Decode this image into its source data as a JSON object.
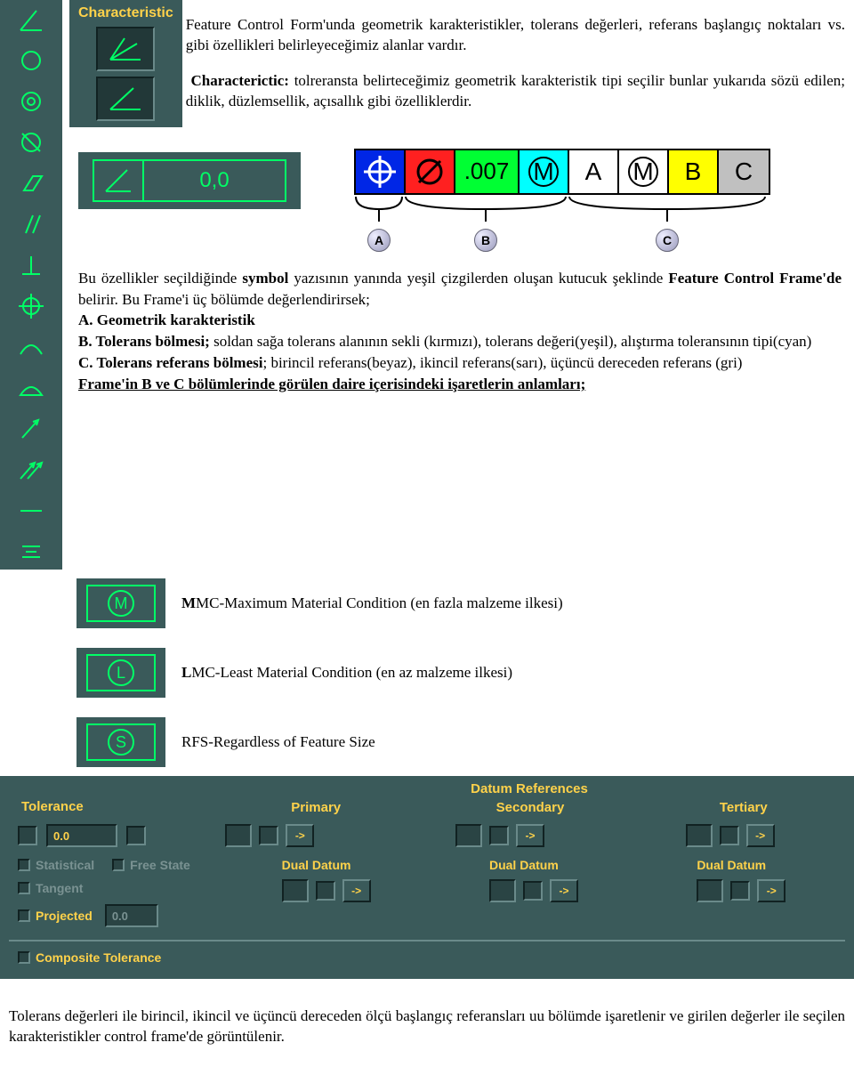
{
  "char_panel": {
    "title": "Characteristic",
    "angle_value": "0,0"
  },
  "intro_para": "Feature Control Form'unda geometrik karakteristikler, tolerans değerleri, referans başlangıç noktaları vs. gibi özellikleri belirleyeceğimiz alanlar vardır.",
  "intro_para2_lead": "Characterictic:",
  "intro_para2_rest": " tolreransta belirteceğimiz geometrik karakteristik tipi seçilir bunlar yukarıda sözü edilen; diklik, düzlemsellik, açısallık gibi özelliklerdir.",
  "fcf": {
    "tol_value": ".007",
    "cyan_letter": "M",
    "datum_primary": "A",
    "datum_primary_mod": "M",
    "datum_secondary": "B",
    "datum_tertiary": "C",
    "labelA": "A",
    "labelB": "B",
    "labelC": "C"
  },
  "section": {
    "p1a": "Bu özellikler seçildiğinde ",
    "p1b": "symbol",
    "p1c": " yazısının yanında yeşil çizgilerden oluşan kutucuk şeklinde ",
    "p1d": "Feature Control Frame'de",
    "p1e": " belirir. Bu Frame'i üç bölümde değerlendirirsek;",
    "A_head": "A. Geometrik karakteristik",
    "B_head": "B. Tolerans bölmesi;",
    "B_rest": " soldan sağa tolerans alanının sekli (kırmızı), tolerans değeri(yeşil), alıştırma toleransının tipi(cyan)",
    "C_head": "C. Tolerans referans bölmesi",
    "C_rest": "; birincil referans(beyaz), ikincil referans(sarı), üçüncü dereceden referans (gri)",
    "frame_note": "Frame'in B ve C bölümlerinde görülen daire içerisindeki işaretlerin anlamları;"
  },
  "symbols": {
    "M": "M",
    "M_text_bold": "M",
    "M_text": "MC-Maximum Material Condition (en fazla malzeme ilkesi)",
    "L": "L",
    "L_text_bold": "L",
    "L_text": "MC-Least Material Condition (en az malzeme ilkesi)",
    "S": "S",
    "S_text": "RFS-Regardless of Feature Size"
  },
  "dr_panel": {
    "tol_label": "Tolerance",
    "dr_title": "Datum References",
    "primary": "Primary",
    "secondary": "Secondary",
    "tertiary": "Tertiary",
    "val0": "0.0",
    "arrow": "->",
    "statistical": "Statistical",
    "free_state": "Free State",
    "tangent": "Tangent",
    "projected": "Projected",
    "proj_val": "0.0",
    "dual_datum": "Dual Datum",
    "composite": "Composite Tolerance"
  },
  "footer": "Tolerans değerleri ile birincil, ikincil ve üçüncü dereceden ölçü başlangıç referansları uu bölümde işaretlenir ve girilen değerler ile seçilen karakteristikler control frame'de görüntülenir."
}
